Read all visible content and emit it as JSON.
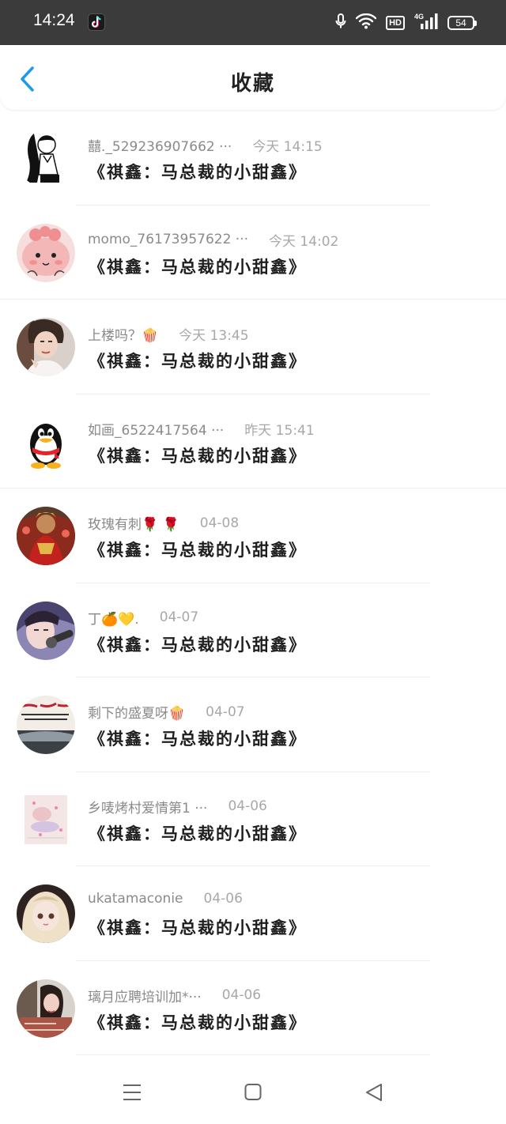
{
  "status_bar": {
    "time": "14:24",
    "network": "4G",
    "hd": "HD",
    "battery": "54"
  },
  "header": {
    "title": "收藏"
  },
  "items": [
    {
      "username": "囍._529236907662 ···",
      "time": "今天 14:15",
      "title": "《祺鑫：马总裁的小甜鑫》",
      "avatar": "line-art-girl"
    },
    {
      "username": "momo_76173957622 ···",
      "time": "今天 14:02",
      "title": "《祺鑫：马总裁的小甜鑫》",
      "avatar": "pink-cartoon"
    },
    {
      "username": "上楼吗？🍿",
      "time": "今天 13:45",
      "title": "《祺鑫：马总裁的小甜鑫》",
      "avatar": "person-photo"
    },
    {
      "username": "如画_6522417564 ···",
      "time": "昨天 15:41",
      "title": "《祺鑫：马总裁的小甜鑫》",
      "avatar": "qq-penguin"
    },
    {
      "username": "玫瑰有刺🌹 🌹",
      "time": "04-08",
      "title": "《祺鑫：马总裁的小甜鑫》",
      "avatar": "red-costume"
    },
    {
      "username": "丁🍊💛.",
      "time": "04-07",
      "title": "《祺鑫：马总裁的小甜鑫》",
      "avatar": "singer-photo"
    },
    {
      "username": "剩下的盛夏呀🍿",
      "time": "04-07",
      "title": "《祺鑫：马总裁的小甜鑫》",
      "avatar": "text-poster"
    },
    {
      "username": "乡唛烤村爱情第1 ···",
      "time": "04-06",
      "title": "《祺鑫：马总裁的小甜鑫》",
      "avatar": "pastel-square"
    },
    {
      "username": "ukatamaconie",
      "time": "04-06",
      "title": "《祺鑫：马总裁的小甜鑫》",
      "avatar": "doll-photo"
    },
    {
      "username": "璃月应聘培训加*···",
      "time": "04-06",
      "title": "《祺鑫：马总裁的小甜鑫》",
      "avatar": "girl-photo"
    }
  ],
  "colors": {
    "status_bar_bg": "#3b3b3b",
    "back_arrow": "#1e9be8",
    "username": "#8a8a8a",
    "timestamp": "#a8a8a8",
    "title_text": "#1e1e1e"
  }
}
